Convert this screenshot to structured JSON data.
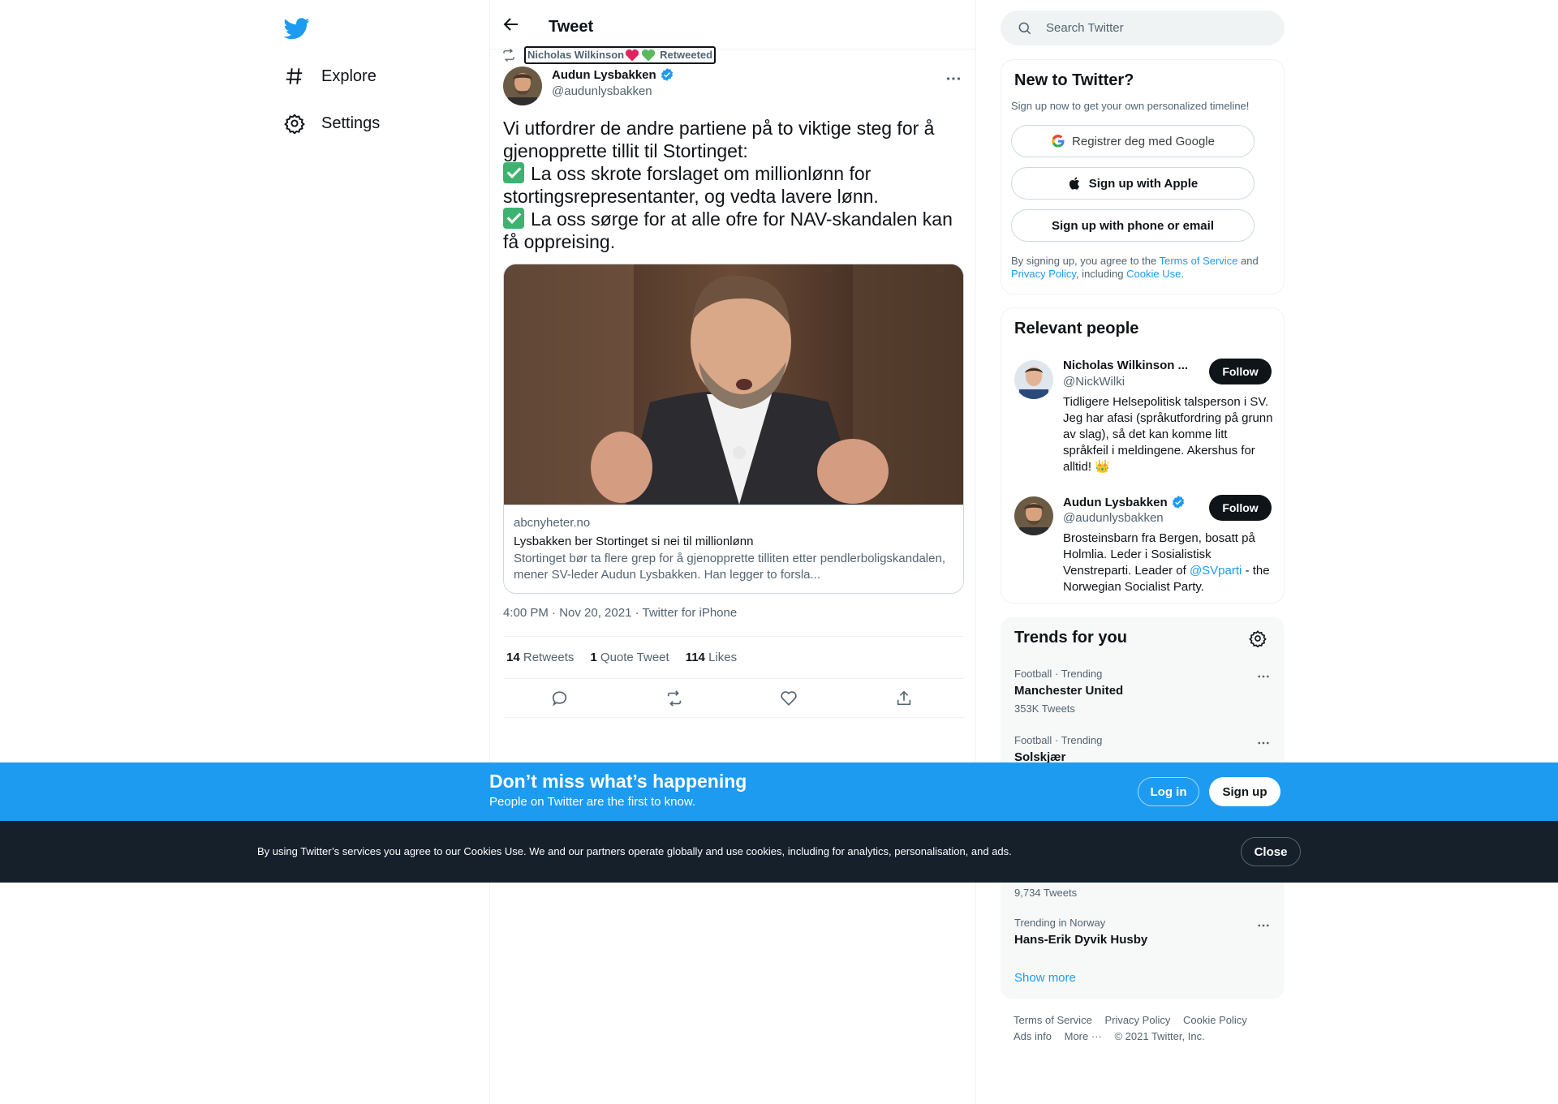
{
  "nav": {
    "explore_label": "Explore",
    "settings_label": "Settings"
  },
  "header": {
    "title": "Tweet"
  },
  "tweet": {
    "retweeted_by": "Nicholas Wilkinson",
    "retweeted_label": "Retweeted",
    "author_name": "Audun Lysbakken",
    "author_handle": "@audunlysbakken",
    "text_intro": "Vi utfordrer de andre partiene på to viktige steg for å gjenopprette tillit til Stortinget:",
    "text_point1": "La oss skrote forslaget om millionlønn for stortingsrepresentanter, og vedta lavere lønn.",
    "text_point2": "La oss sørge for at alle ofre for NAV-skandalen kan få oppreising.",
    "card": {
      "domain": "abcnyheter.no",
      "title": "Lysbakken ber Stortinget si nei til millionlønn",
      "description": "Stortinget bør ta flere grep for å gjenopprette tilliten etter pendlerboligskandalen, mener SV-leder Audun Lysbakken. Han legger to forsla..."
    },
    "timestamp": "4:00 PM · Nov 20, 2021 · Twitter for iPhone",
    "retweets_count": "14",
    "retweets_label": "Retweets",
    "quotes_count": "1",
    "quotes_label": "Quote Tweet",
    "likes_count": "114",
    "likes_label": "Likes"
  },
  "search": {
    "placeholder": "Search Twitter"
  },
  "new_to_twitter": {
    "title": "New to Twitter?",
    "subtitle": "Sign up now to get your own personalized timeline!",
    "google_btn": "Registrer deg med Google",
    "apple_btn": "Sign up with Apple",
    "phone_btn": "Sign up with phone or email",
    "terms_prefix": "By signing up, you agree to the ",
    "terms_link": "Terms of Service",
    "terms_and": " and ",
    "privacy_link": "Privacy Policy",
    "terms_including": ", including ",
    "cookie_link": "Cookie Use",
    "terms_end": "."
  },
  "relevant_people": {
    "title": "Relevant people",
    "people": [
      {
        "name": "Nicholas Wilkinson ...",
        "handle": "@NickWilki",
        "bio": "Tidligere Helsepolitisk talsperson i SV. Jeg har afasi (språkutfordring på grunn av slag), så det kan komme litt språkfeil i meldingene. Akershus for alltid! 👑",
        "follow_label": "Follow"
      },
      {
        "name": "Audun Lysbakken",
        "handle": "@audunlysbakken",
        "bio_prefix": "Brosteinsbarn fra Bergen, bosatt på Holmlia. Leder i Sosialistisk Venstreparti. Leader of ",
        "bio_link": "@SVparti",
        "bio_suffix": " - the Norwegian Socialist Party.",
        "follow_label": "Follow"
      }
    ]
  },
  "trends": {
    "title": "Trends for you",
    "items": [
      {
        "meta": "Football · Trending",
        "name": "Manchester United",
        "count": "353K Tweets"
      },
      {
        "meta": "Football · Trending",
        "name": "Solskjær",
        "count": ""
      },
      {
        "meta": "",
        "name": "",
        "count": "9,734 Tweets"
      },
      {
        "meta": "Trending in Norway",
        "name": "Hans-Erik Dyvik Husby",
        "count": ""
      }
    ],
    "show_more": "Show more"
  },
  "footer": {
    "terms": "Terms of Service",
    "privacy": "Privacy Policy",
    "cookie": "Cookie Policy",
    "ads": "Ads info",
    "more": "More ···",
    "copyright": "© 2021 Twitter, Inc."
  },
  "signup_banner": {
    "title": "Don’t miss what’s happening",
    "subtitle": "People on Twitter are the first to know.",
    "login_label": "Log in",
    "signup_label": "Sign up"
  },
  "cookie_banner": {
    "text": "By using Twitter’s services you agree to our Cookies Use. We and our partners operate globally and use cookies, including for analytics, personalisation, and ads.",
    "close_label": "Close"
  },
  "colors": {
    "accent": "#1d9bf0",
    "text": "#0f1419",
    "secondary": "#536471",
    "cookie_bg": "#15202b"
  }
}
